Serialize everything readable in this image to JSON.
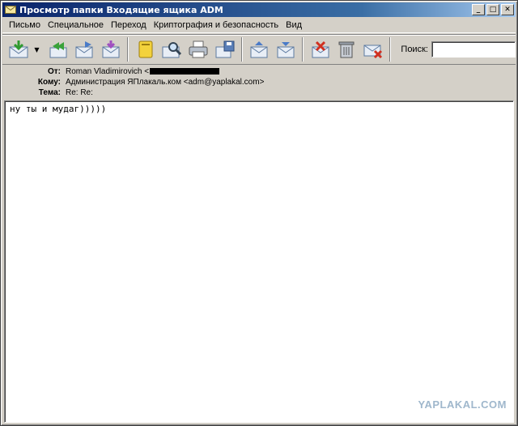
{
  "window": {
    "title": "Просмотр папки Входящие ящика ADM",
    "buttons": {
      "minimize": "_",
      "maximize": "□",
      "close": "✕"
    }
  },
  "menu": {
    "items": [
      {
        "label": "Письмо"
      },
      {
        "label": "Специальное"
      },
      {
        "label": "Переход"
      },
      {
        "label": "Криптография и безопасность"
      },
      {
        "label": "Вид"
      }
    ]
  },
  "toolbar": {
    "icons": [
      "receive-icon",
      "dropdown-arrow-icon",
      "reply-all-icon",
      "forward-icon",
      "redirect-icon",
      "address-book-icon",
      "find-icon",
      "print-icon",
      "save-icon",
      "prev-message-icon",
      "next-message-icon",
      "spam-icon",
      "delete-icon",
      "block-sender-icon"
    ],
    "search_label": "Поиск:",
    "search_value": ""
  },
  "message": {
    "from_label": "От:",
    "from_value": "Roman Vladimirovich <",
    "to_label": "Кому:",
    "to_value": "Администрация ЯПлакаль.ком <adm@yaplakal.com>",
    "subject_label": "Тема:",
    "subject_value": "Re: Re:",
    "body": "ну ты и мудаг)))))"
  },
  "watermark": "YAPLAKAL.COM",
  "colors": {
    "titlebar_start": "#0a246a",
    "titlebar_end": "#a6caf0",
    "face": "#d4d0c8"
  }
}
